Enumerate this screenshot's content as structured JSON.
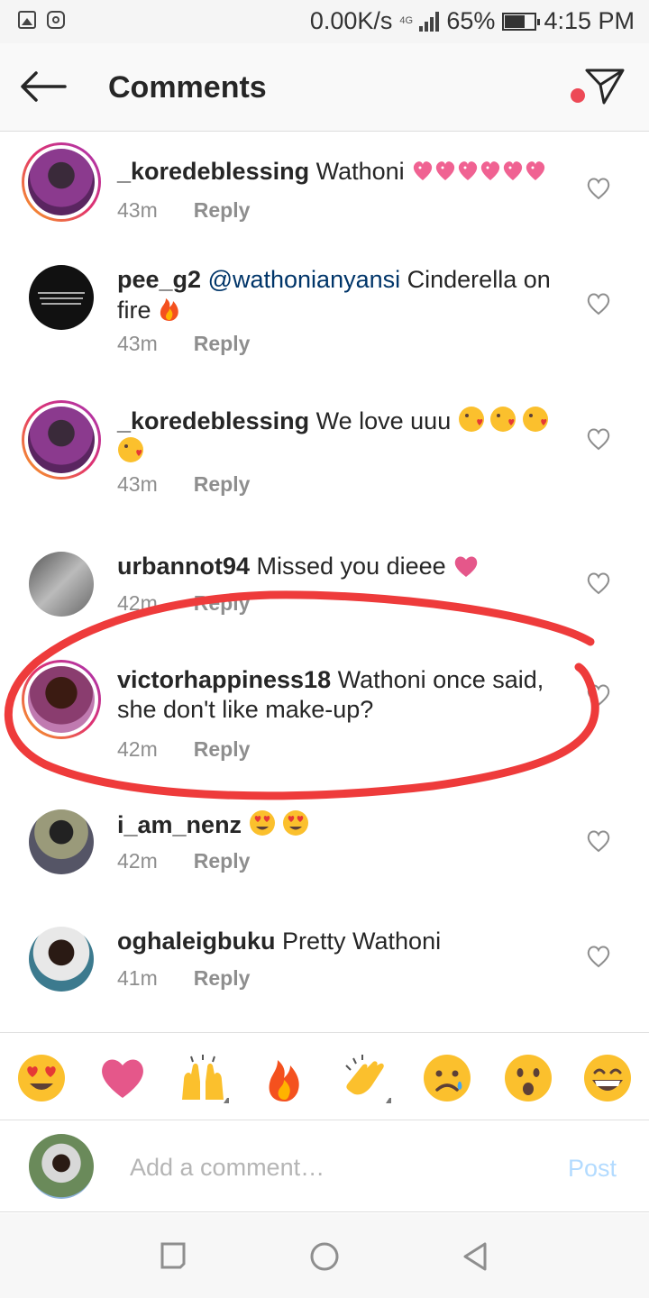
{
  "status_bar": {
    "network_speed": "0.00K/s",
    "network_type": "4G",
    "battery": "65%",
    "time": "4:15 PM",
    "icons": [
      "gallery-icon",
      "instagram-icon",
      "signal-icon",
      "battery-icon"
    ]
  },
  "header": {
    "title": "Comments",
    "accent_dot_color": "#ed4956"
  },
  "comments": [
    {
      "username": "_koredeblessing",
      "mention": "",
      "text_line1": "Wathoni",
      "text_line2": "",
      "emojis_line1": [
        "sparkling-heart",
        "sparkling-heart",
        "sparkling-heart",
        "sparkling-heart",
        "sparkling-heart",
        "sparkling-heart"
      ],
      "emojis_line2": [],
      "time": "43m",
      "reply": "Reply",
      "story_ring": true
    },
    {
      "username": "pee_g2",
      "mention": "@wathonianyansi",
      "text_line1": "Cinderella on",
      "text_line2": "fire",
      "emojis_line1": [],
      "emojis_line2": [
        "fire"
      ],
      "time": "43m",
      "reply": "Reply",
      "story_ring": false
    },
    {
      "username": "_koredeblessing",
      "mention": "",
      "text_line1": "We love uuu",
      "text_line2": "",
      "emojis_line1": [
        "kissing-face",
        "kissing-face",
        "kissing-face"
      ],
      "emojis_line2": [
        "kissing-face"
      ],
      "time": "43m",
      "reply": "Reply",
      "story_ring": true
    },
    {
      "username": "urbannot94",
      "mention": "",
      "text_line1": "Missed you dieee",
      "text_line2": "",
      "emojis_line1": [
        "heart"
      ],
      "emojis_line2": [],
      "time": "42m",
      "reply": "Reply",
      "story_ring": false
    },
    {
      "username": "victorhappiness18",
      "mention": "",
      "text_line1": "Wathoni once said,",
      "text_line2": "she don't like make-up?",
      "emojis_line1": [],
      "emojis_line2": [],
      "time": "42m",
      "reply": "Reply",
      "story_ring": true
    },
    {
      "username": "i_am_nenz",
      "mention": "",
      "text_line1": "",
      "text_line2": "",
      "emojis_line1": [
        "heart-eyes",
        "heart-eyes"
      ],
      "emojis_line2": [],
      "time": "42m",
      "reply": "Reply",
      "story_ring": false
    },
    {
      "username": "oghaleigbuku",
      "mention": "",
      "text_line1": "Pretty Wathoni",
      "text_line2": "",
      "emojis_line1": [],
      "emojis_line2": [],
      "time": "41m",
      "reply": "Reply",
      "story_ring": false
    }
  ],
  "quick_emojis": [
    "heart-eyes",
    "heart",
    "raised-hands",
    "fire",
    "clapping-hands",
    "sad-face",
    "surprised-face",
    "grinning-face"
  ],
  "composer": {
    "placeholder": "Add a comment…",
    "post_label": "Post"
  },
  "nav_bar": [
    "recents-square-icon",
    "home-circle-icon",
    "back-triangle-icon"
  ],
  "colors": {
    "accent": "#ed4956",
    "mention": "#003569",
    "meta": "#8e8e8e",
    "post_disabled": "#b3dbff",
    "annotation": "#ee3b3b"
  }
}
